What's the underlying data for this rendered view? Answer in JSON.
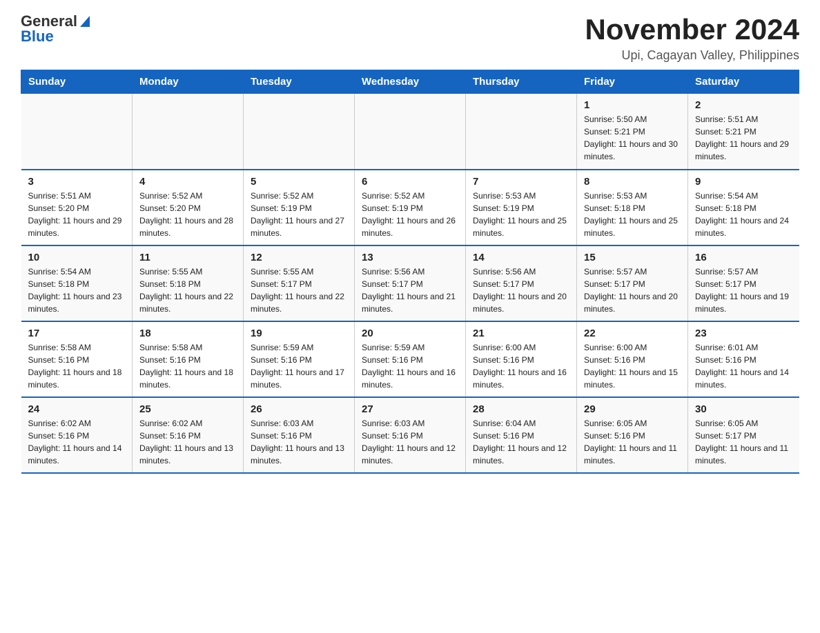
{
  "logo": {
    "general": "General",
    "blue": "Blue"
  },
  "header": {
    "title": "November 2024",
    "subtitle": "Upi, Cagayan Valley, Philippines"
  },
  "weekdays": [
    "Sunday",
    "Monday",
    "Tuesday",
    "Wednesday",
    "Thursday",
    "Friday",
    "Saturday"
  ],
  "weeks": [
    [
      {
        "day": "",
        "info": ""
      },
      {
        "day": "",
        "info": ""
      },
      {
        "day": "",
        "info": ""
      },
      {
        "day": "",
        "info": ""
      },
      {
        "day": "",
        "info": ""
      },
      {
        "day": "1",
        "info": "Sunrise: 5:50 AM\nSunset: 5:21 PM\nDaylight: 11 hours and 30 minutes."
      },
      {
        "day": "2",
        "info": "Sunrise: 5:51 AM\nSunset: 5:21 PM\nDaylight: 11 hours and 29 minutes."
      }
    ],
    [
      {
        "day": "3",
        "info": "Sunrise: 5:51 AM\nSunset: 5:20 PM\nDaylight: 11 hours and 29 minutes."
      },
      {
        "day": "4",
        "info": "Sunrise: 5:52 AM\nSunset: 5:20 PM\nDaylight: 11 hours and 28 minutes."
      },
      {
        "day": "5",
        "info": "Sunrise: 5:52 AM\nSunset: 5:19 PM\nDaylight: 11 hours and 27 minutes."
      },
      {
        "day": "6",
        "info": "Sunrise: 5:52 AM\nSunset: 5:19 PM\nDaylight: 11 hours and 26 minutes."
      },
      {
        "day": "7",
        "info": "Sunrise: 5:53 AM\nSunset: 5:19 PM\nDaylight: 11 hours and 25 minutes."
      },
      {
        "day": "8",
        "info": "Sunrise: 5:53 AM\nSunset: 5:18 PM\nDaylight: 11 hours and 25 minutes."
      },
      {
        "day": "9",
        "info": "Sunrise: 5:54 AM\nSunset: 5:18 PM\nDaylight: 11 hours and 24 minutes."
      }
    ],
    [
      {
        "day": "10",
        "info": "Sunrise: 5:54 AM\nSunset: 5:18 PM\nDaylight: 11 hours and 23 minutes."
      },
      {
        "day": "11",
        "info": "Sunrise: 5:55 AM\nSunset: 5:18 PM\nDaylight: 11 hours and 22 minutes."
      },
      {
        "day": "12",
        "info": "Sunrise: 5:55 AM\nSunset: 5:17 PM\nDaylight: 11 hours and 22 minutes."
      },
      {
        "day": "13",
        "info": "Sunrise: 5:56 AM\nSunset: 5:17 PM\nDaylight: 11 hours and 21 minutes."
      },
      {
        "day": "14",
        "info": "Sunrise: 5:56 AM\nSunset: 5:17 PM\nDaylight: 11 hours and 20 minutes."
      },
      {
        "day": "15",
        "info": "Sunrise: 5:57 AM\nSunset: 5:17 PM\nDaylight: 11 hours and 20 minutes."
      },
      {
        "day": "16",
        "info": "Sunrise: 5:57 AM\nSunset: 5:17 PM\nDaylight: 11 hours and 19 minutes."
      }
    ],
    [
      {
        "day": "17",
        "info": "Sunrise: 5:58 AM\nSunset: 5:16 PM\nDaylight: 11 hours and 18 minutes."
      },
      {
        "day": "18",
        "info": "Sunrise: 5:58 AM\nSunset: 5:16 PM\nDaylight: 11 hours and 18 minutes."
      },
      {
        "day": "19",
        "info": "Sunrise: 5:59 AM\nSunset: 5:16 PM\nDaylight: 11 hours and 17 minutes."
      },
      {
        "day": "20",
        "info": "Sunrise: 5:59 AM\nSunset: 5:16 PM\nDaylight: 11 hours and 16 minutes."
      },
      {
        "day": "21",
        "info": "Sunrise: 6:00 AM\nSunset: 5:16 PM\nDaylight: 11 hours and 16 minutes."
      },
      {
        "day": "22",
        "info": "Sunrise: 6:00 AM\nSunset: 5:16 PM\nDaylight: 11 hours and 15 minutes."
      },
      {
        "day": "23",
        "info": "Sunrise: 6:01 AM\nSunset: 5:16 PM\nDaylight: 11 hours and 14 minutes."
      }
    ],
    [
      {
        "day": "24",
        "info": "Sunrise: 6:02 AM\nSunset: 5:16 PM\nDaylight: 11 hours and 14 minutes."
      },
      {
        "day": "25",
        "info": "Sunrise: 6:02 AM\nSunset: 5:16 PM\nDaylight: 11 hours and 13 minutes."
      },
      {
        "day": "26",
        "info": "Sunrise: 6:03 AM\nSunset: 5:16 PM\nDaylight: 11 hours and 13 minutes."
      },
      {
        "day": "27",
        "info": "Sunrise: 6:03 AM\nSunset: 5:16 PM\nDaylight: 11 hours and 12 minutes."
      },
      {
        "day": "28",
        "info": "Sunrise: 6:04 AM\nSunset: 5:16 PM\nDaylight: 11 hours and 12 minutes."
      },
      {
        "day": "29",
        "info": "Sunrise: 6:05 AM\nSunset: 5:16 PM\nDaylight: 11 hours and 11 minutes."
      },
      {
        "day": "30",
        "info": "Sunrise: 6:05 AM\nSunset: 5:17 PM\nDaylight: 11 hours and 11 minutes."
      }
    ]
  ]
}
